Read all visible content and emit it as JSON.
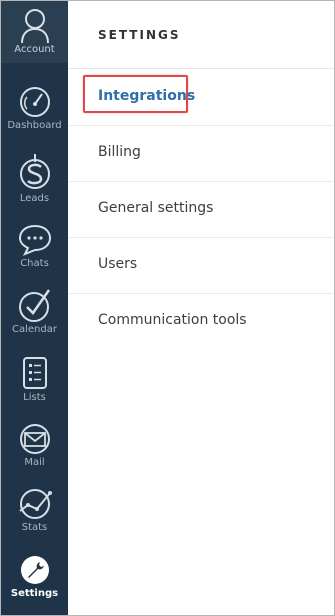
{
  "sidebar": {
    "items": [
      {
        "id": "account",
        "label": "Account",
        "icon": "user-icon"
      },
      {
        "id": "dashboard",
        "label": "Dashboard",
        "icon": "speedometer-icon"
      },
      {
        "id": "leads",
        "label": "Leads",
        "icon": "dollar-icon"
      },
      {
        "id": "chats",
        "label": "Chats",
        "icon": "chat-bubble-icon"
      },
      {
        "id": "calendar",
        "label": "Calendar",
        "icon": "checkmark-icon"
      },
      {
        "id": "lists",
        "label": "Lists",
        "icon": "list-icon"
      },
      {
        "id": "mail",
        "label": "Mail",
        "icon": "envelope-icon"
      },
      {
        "id": "stats",
        "label": "Stats",
        "icon": "graph-icon"
      },
      {
        "id": "settings",
        "label": "Settings",
        "icon": "wrench-icon",
        "active": true
      }
    ]
  },
  "settings": {
    "title": "SETTINGS",
    "menu": [
      {
        "label": "Integrations",
        "selected": true
      },
      {
        "label": "Billing"
      },
      {
        "label": "General settings"
      },
      {
        "label": "Users"
      },
      {
        "label": "Communication tools"
      }
    ]
  },
  "colors": {
    "sidebar_bg": "#1f3448",
    "accent_blue": "#2f6ea8",
    "highlight_red": "#e0474c"
  }
}
